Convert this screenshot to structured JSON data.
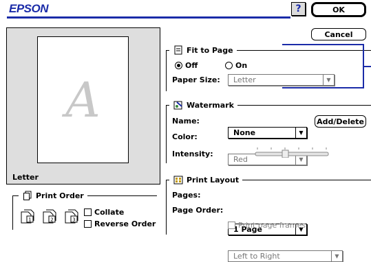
{
  "header": {
    "brand": "EPSON",
    "help_label": "?",
    "ok_label": "OK",
    "cancel_label": "Cancel"
  },
  "preview": {
    "page_glyph": "A",
    "paper_label": "Letter"
  },
  "print_order": {
    "title": "Print Order",
    "collate_label": "Collate",
    "reverse_label": "Reverse Order",
    "page_icons": [
      "1",
      "2",
      "3"
    ]
  },
  "fit_to_page": {
    "title": "Fit to Page",
    "off_label": "Off",
    "on_label": "On",
    "selected": "Off",
    "paper_size_label": "Paper Size:",
    "paper_size_value": "Letter"
  },
  "watermark": {
    "title": "Watermark",
    "name_label": "Name:",
    "name_value": "None",
    "add_delete_label": "Add/Delete",
    "color_label": "Color:",
    "color_value": "Red",
    "intensity_label": "Intensity:"
  },
  "print_layout": {
    "title": "Print Layout",
    "pages_label": "Pages:",
    "pages_value": "1 Page",
    "page_order_label": "Page Order:",
    "page_order_value": "Left to Right",
    "frames_label": "Print page frames"
  },
  "colors": {
    "brand_blue": "#1a2ba8",
    "preview_bg": "#dedede"
  },
  "icons": [
    "help-icon",
    "print-order-icon",
    "fit-page-icon",
    "watermark-icon",
    "print-layout-icon",
    "chevron-down-icon"
  ]
}
